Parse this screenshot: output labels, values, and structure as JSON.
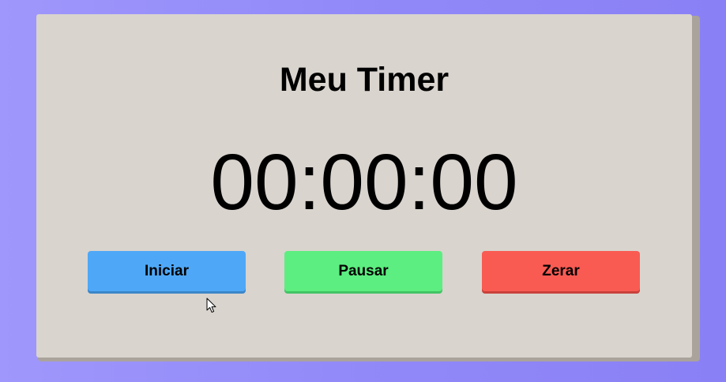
{
  "timer": {
    "title": "Meu Timer",
    "display": "00:00:00"
  },
  "controls": {
    "start_label": "Iniciar",
    "pause_label": "Pausar",
    "reset_label": "Zerar"
  },
  "colors": {
    "background": "#9189f8",
    "card": "#d9d4ce",
    "start": "#4fa8f7",
    "pause": "#5cee80",
    "reset": "#f95b53"
  }
}
